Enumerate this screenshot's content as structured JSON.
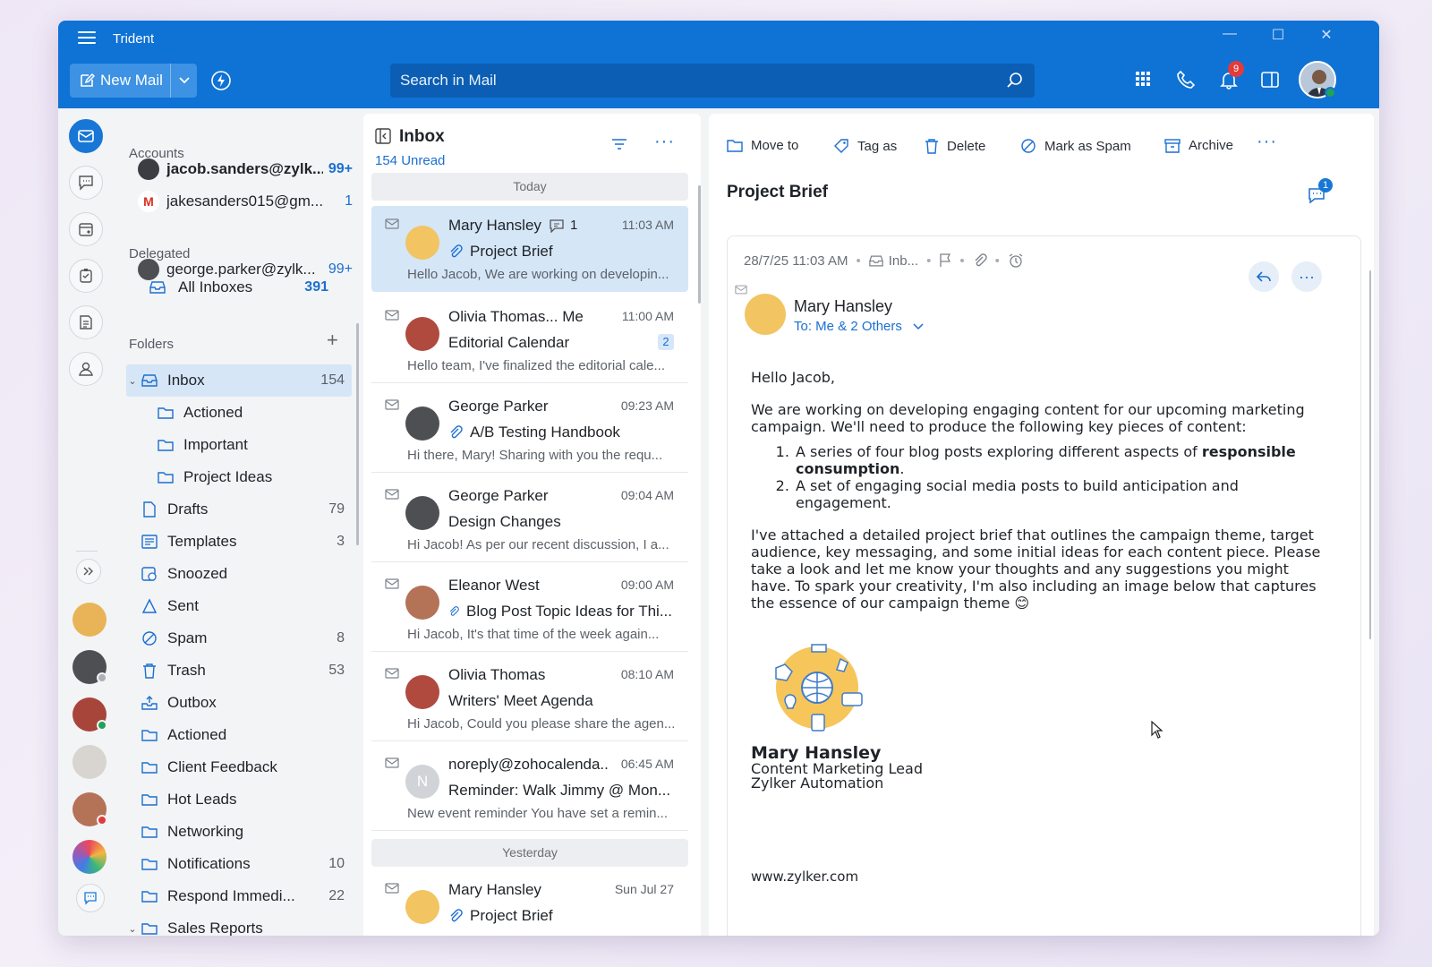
{
  "app": {
    "title": "Trident"
  },
  "toolbar": {
    "new_mail": "New Mail",
    "search_placeholder": "Search in Mail",
    "notif_count": "9"
  },
  "accounts": {
    "heading": "Accounts",
    "items": [
      {
        "email": "jacob.sanders@zylk...",
        "count": "99+"
      },
      {
        "email": "jakesanders015@gm...",
        "count": "1"
      }
    ]
  },
  "delegated": {
    "heading": "Delegated",
    "items": [
      {
        "email": "george.parker@zylk...",
        "count": "99+"
      },
      {
        "email": "All Inboxes",
        "count": "391"
      }
    ]
  },
  "folders": {
    "heading": "Folders",
    "items": [
      {
        "name": "Inbox",
        "count": "154"
      },
      {
        "name": "Actioned",
        "count": ""
      },
      {
        "name": "Important",
        "count": ""
      },
      {
        "name": "Project Ideas",
        "count": ""
      },
      {
        "name": "Drafts",
        "count": "79"
      },
      {
        "name": "Templates",
        "count": "3"
      },
      {
        "name": "Snoozed",
        "count": ""
      },
      {
        "name": "Sent",
        "count": ""
      },
      {
        "name": "Spam",
        "count": "8"
      },
      {
        "name": "Trash",
        "count": "53"
      },
      {
        "name": "Outbox",
        "count": ""
      },
      {
        "name": "Actioned",
        "count": ""
      },
      {
        "name": "Client Feedback",
        "count": ""
      },
      {
        "name": "Hot Leads",
        "count": ""
      },
      {
        "name": "Networking",
        "count": ""
      },
      {
        "name": "Notifications",
        "count": "10"
      },
      {
        "name": "Respond Immedi...",
        "count": "22"
      },
      {
        "name": "Sales Reports",
        "count": ""
      }
    ]
  },
  "list": {
    "title": "Inbox",
    "unread": "154 Unread",
    "today": "Today",
    "yesterday": "Yesterday",
    "messages": [
      {
        "sender": "Mary Hansley",
        "conv_count": "1",
        "time": "11:03 AM",
        "subject": "Project Brief",
        "preview": "Hello Jacob, We are working on developin..."
      },
      {
        "sender": "Olivia Thomas... Me",
        "time": "11:00 AM",
        "subject": "Editorial Calendar",
        "thread_count": "2",
        "preview": "Hello team, I've finalized the editorial cale..."
      },
      {
        "sender": "George Parker",
        "time": "09:23 AM",
        "subject": "A/B Testing Handbook",
        "preview": "Hi there, Mary! Sharing with you the requ..."
      },
      {
        "sender": "George Parker",
        "time": "09:04 AM",
        "subject": "Design Changes",
        "preview": "Hi Jacob! As per our recent discussion, I a..."
      },
      {
        "sender": "Eleanor West",
        "time": "09:00 AM",
        "subject": "Blog Post Topic Ideas for Thi...",
        "preview": "Hi Jacob, It's that time of the week again..."
      },
      {
        "sender": "Olivia Thomas",
        "time": "08:10 AM",
        "subject": "Writers' Meet Agenda",
        "preview": "Hi Jacob, Could you please share the agen..."
      },
      {
        "sender": "noreply@zohocalenda...",
        "initial": "N",
        "time": "06:45 AM",
        "subject": "Reminder: Walk Jimmy @ Mon...",
        "preview": "New event reminder You have set a remin..."
      },
      {
        "sender": "Mary Hansley",
        "time": "Sun Jul 27",
        "subject": "Project Brief",
        "preview": ""
      }
    ]
  },
  "reader": {
    "actions": {
      "move": "Move to",
      "tag": "Tag as",
      "delete": "Delete",
      "spam": "Mark as Spam",
      "archive": "Archive"
    },
    "subject": "Project Brief",
    "chat_count": "1",
    "meta_date": "28/7/25 11:03 AM",
    "meta_folder": "Inb...",
    "from": "Mary Hansley",
    "to": "To: Me & 2 Others",
    "greeting": "Hello Jacob,",
    "para1": "We are working on developing engaging content for our upcoming marketing campaign. We'll need to produce the following key pieces of content:",
    "item1_pre": "A series of four blog posts exploring different aspects of ",
    "item1_bold": "responsible consumption",
    "item1_post": ".",
    "item2": "A set of engaging social media posts to build anticipation and engagement.",
    "para2": "I've attached a detailed project brief that outlines the campaign theme, target audience, key messaging, and some initial ideas for each content piece. Please take a look and let me know your thoughts and any suggestions you might have. To spark your creativity, I'm also including an image below that captures the essence of our campaign theme 😊",
    "sig_name": "Mary Hansley",
    "sig_title": "Content Marketing Lead",
    "sig_company": "Zylker Automation",
    "sig_url": "www.zylker.com"
  },
  "colors": {
    "brand": "#0f72d5",
    "selected": "#d5e6f7",
    "link": "#1b6fd0"
  }
}
